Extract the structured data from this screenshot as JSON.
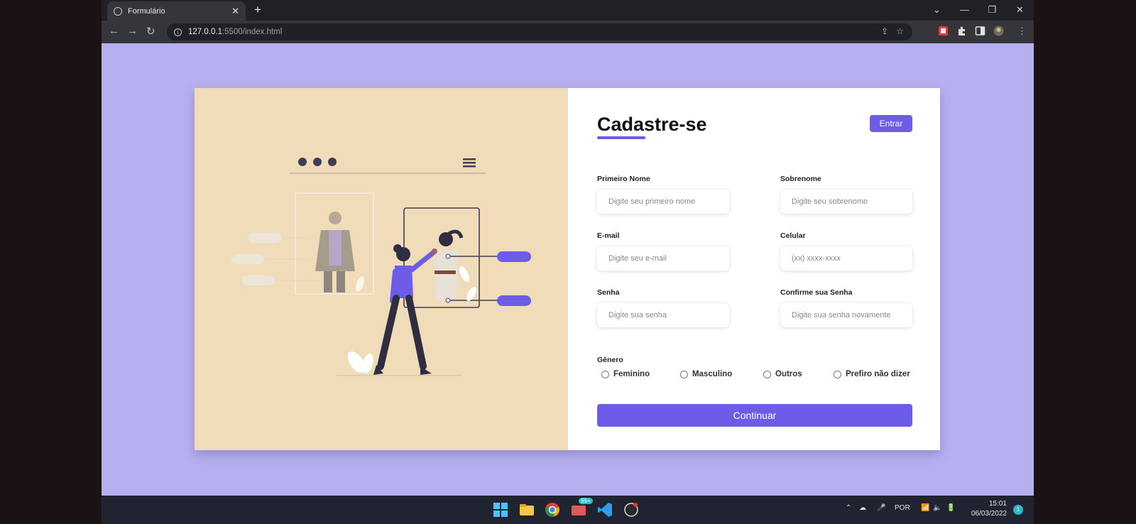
{
  "browser": {
    "tab_title": "Formulário",
    "tab_close": "✕",
    "new_tab": "+",
    "url_host": "127.0.0.1",
    "url_rest": ":5500/index.html",
    "window_controls": [
      "⌄",
      "—",
      "❐",
      "✕"
    ]
  },
  "form": {
    "title": "Cadastre-se",
    "login_button": "Entrar",
    "fields": [
      {
        "label": "Primeiro Nome",
        "placeholder": "Digite seu primeiro nome"
      },
      {
        "label": "Sobrenome",
        "placeholder": "Digite seu sobrenome"
      },
      {
        "label": "E-mail",
        "placeholder": "Digite seu e-mail"
      },
      {
        "label": "Celular",
        "placeholder": "(xx) xxxx-xxxx"
      },
      {
        "label": "Senha",
        "placeholder": "Digite sua senha"
      },
      {
        "label": "Confirme sua Senha",
        "placeholder": "Digite sua senha novamente"
      }
    ],
    "gender_label": "Gênero",
    "gender_options": [
      "Feminino",
      "Masculino",
      "Outros",
      "Prefiro não dizer"
    ],
    "submit_button": "Continuar"
  },
  "taskbar": {
    "language": "POR",
    "time": "15:01",
    "date": "06/03/2022",
    "badge": "99+",
    "notif_count": "1"
  },
  "colors": {
    "page_bg": "#b6b0f0",
    "accent": "#6c5ce7",
    "illustration_bg": "#f0dcb8"
  }
}
